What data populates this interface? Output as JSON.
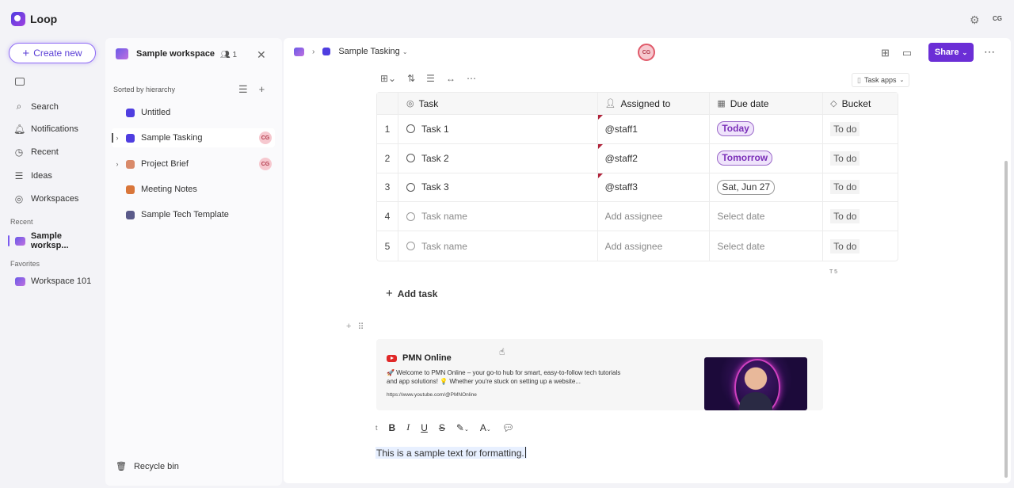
{
  "app": {
    "name": "Loop",
    "user_initials": "CG"
  },
  "leftnav": {
    "create_label": "Create new",
    "items": [
      {
        "label": "Search",
        "icon": "search-icon"
      },
      {
        "label": "Notifications",
        "icon": "bell-icon"
      },
      {
        "label": "Recent",
        "icon": "clock-icon"
      },
      {
        "label": "Ideas",
        "icon": "ideas-icon"
      },
      {
        "label": "Workspaces",
        "icon": "workspaces-icon"
      }
    ],
    "recent_label": "Recent",
    "recent_item": "Sample worksp...",
    "favorites_label": "Favorites",
    "favorite_item": "Workspace 101"
  },
  "workspace": {
    "title": "Sample workspace",
    "member_count": "1",
    "sorted_label": "Sorted by hierarchy",
    "items": [
      {
        "label": "Untitled"
      },
      {
        "label": "Sample Tasking",
        "avatar": "CG"
      },
      {
        "label": "Project Brief",
        "avatar": "CG"
      },
      {
        "label": "Meeting Notes"
      },
      {
        "label": "Sample Tech Template"
      }
    ],
    "recycle_label": "Recycle bin"
  },
  "doc": {
    "breadcrumb": "Sample Tasking",
    "presence": "CG",
    "share_label": "Share",
    "task_apps_label": "Task apps",
    "columns": {
      "task": "Task",
      "assigned": "Assigned to",
      "due": "Due date",
      "bucket": "Bucket"
    },
    "rows": [
      {
        "num": "1",
        "task": "Task 1",
        "assignee": "@staff1",
        "due": "Today",
        "bucket": "To do"
      },
      {
        "num": "2",
        "task": "Task 2",
        "assignee": "@staff2",
        "due": "Tomorrow",
        "bucket": "To do"
      },
      {
        "num": "3",
        "task": "Task 3",
        "assignee": "@staff3",
        "due": "Sat, Jun 27",
        "bucket": "To do"
      },
      {
        "num": "4",
        "task": "Task name",
        "assignee": "Add assignee",
        "due": "Select date",
        "bucket": "To do"
      },
      {
        "num": "5",
        "task": "Task name",
        "assignee": "Add assignee",
        "due": "Select date",
        "bucket": "To do"
      }
    ],
    "summary": "T 5",
    "add_task_label": "Add task",
    "embed": {
      "channel": "PMN Online",
      "description": "🚀 Welcome to PMN Online – your go-to hub for smart, easy-to-follow tech tutorials and app solutions! 💡 Whether you're stuck on setting up a website...",
      "url": "https://www.youtube.com/@PMNOnline"
    },
    "format_toolbar": {
      "partial": "t",
      "bold": "B",
      "italic": "I",
      "underline": "U",
      "strike": "S"
    },
    "sample_text": "This is a sample text for formatting."
  },
  "colors": {
    "accent": "#6b2ed6",
    "create_border": "#8f6cf5",
    "presence_ring": "#e05a6a"
  }
}
